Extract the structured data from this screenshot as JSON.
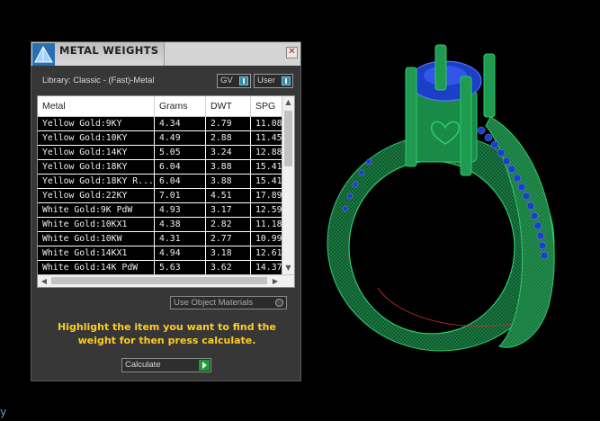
{
  "dialog": {
    "title": "METAL WEIGHTS",
    "close_symbol": "✕",
    "library_label": "Library: Classic - (Fast)-Metal",
    "toggles": [
      {
        "label": "GV"
      },
      {
        "label": "User"
      }
    ],
    "table": {
      "columns": [
        "Metal",
        "Grams",
        "DWT",
        "SPG"
      ],
      "rows": [
        {
          "metal": "Yellow Gold:9KY",
          "grams": "4.34",
          "dwt": "2.79",
          "spg": "11.08"
        },
        {
          "metal": "Yellow Gold:10KY",
          "grams": "4.49",
          "dwt": "2.88",
          "spg": "11.45"
        },
        {
          "metal": "Yellow Gold:14KY",
          "grams": "5.05",
          "dwt": "3.24",
          "spg": "12.88"
        },
        {
          "metal": "Yellow Gold:18KY",
          "grams": "6.04",
          "dwt": "3.88",
          "spg": "15.41"
        },
        {
          "metal": "Yellow Gold:18KY R...",
          "grams": "6.04",
          "dwt": "3.88",
          "spg": "15.41"
        },
        {
          "metal": "Yellow Gold:22KY",
          "grams": "7.01",
          "dwt": "4.51",
          "spg": "17.89"
        },
        {
          "metal": "White Gold:9K PdW",
          "grams": "4.93",
          "dwt": "3.17",
          "spg": "12.59"
        },
        {
          "metal": "White Gold:10KX1",
          "grams": "4.38",
          "dwt": "2.82",
          "spg": "11.18"
        },
        {
          "metal": "White Gold:10KW",
          "grams": "4.31",
          "dwt": "2.77",
          "spg": "10.99"
        },
        {
          "metal": "White Gold:14KX1",
          "grams": "4.94",
          "dwt": "3.18",
          "spg": "12.61"
        },
        {
          "metal": "White Gold:14K PdW",
          "grams": "5.63",
          "dwt": "3.62",
          "spg": "14.37"
        }
      ]
    },
    "use_object_materials_label": "Use Object Materials",
    "hint_text": "Highlight the item you want to find the weight for then press calculate.",
    "calculate_label": "Calculate"
  },
  "corner_glyph": "y",
  "colors": {
    "background": "#000000",
    "hint_yellow": "#ffcc22",
    "ring_green": "#1f8a4a",
    "gem_blue": "#1b3fc7",
    "accent_teal": "#2f8aa8"
  }
}
